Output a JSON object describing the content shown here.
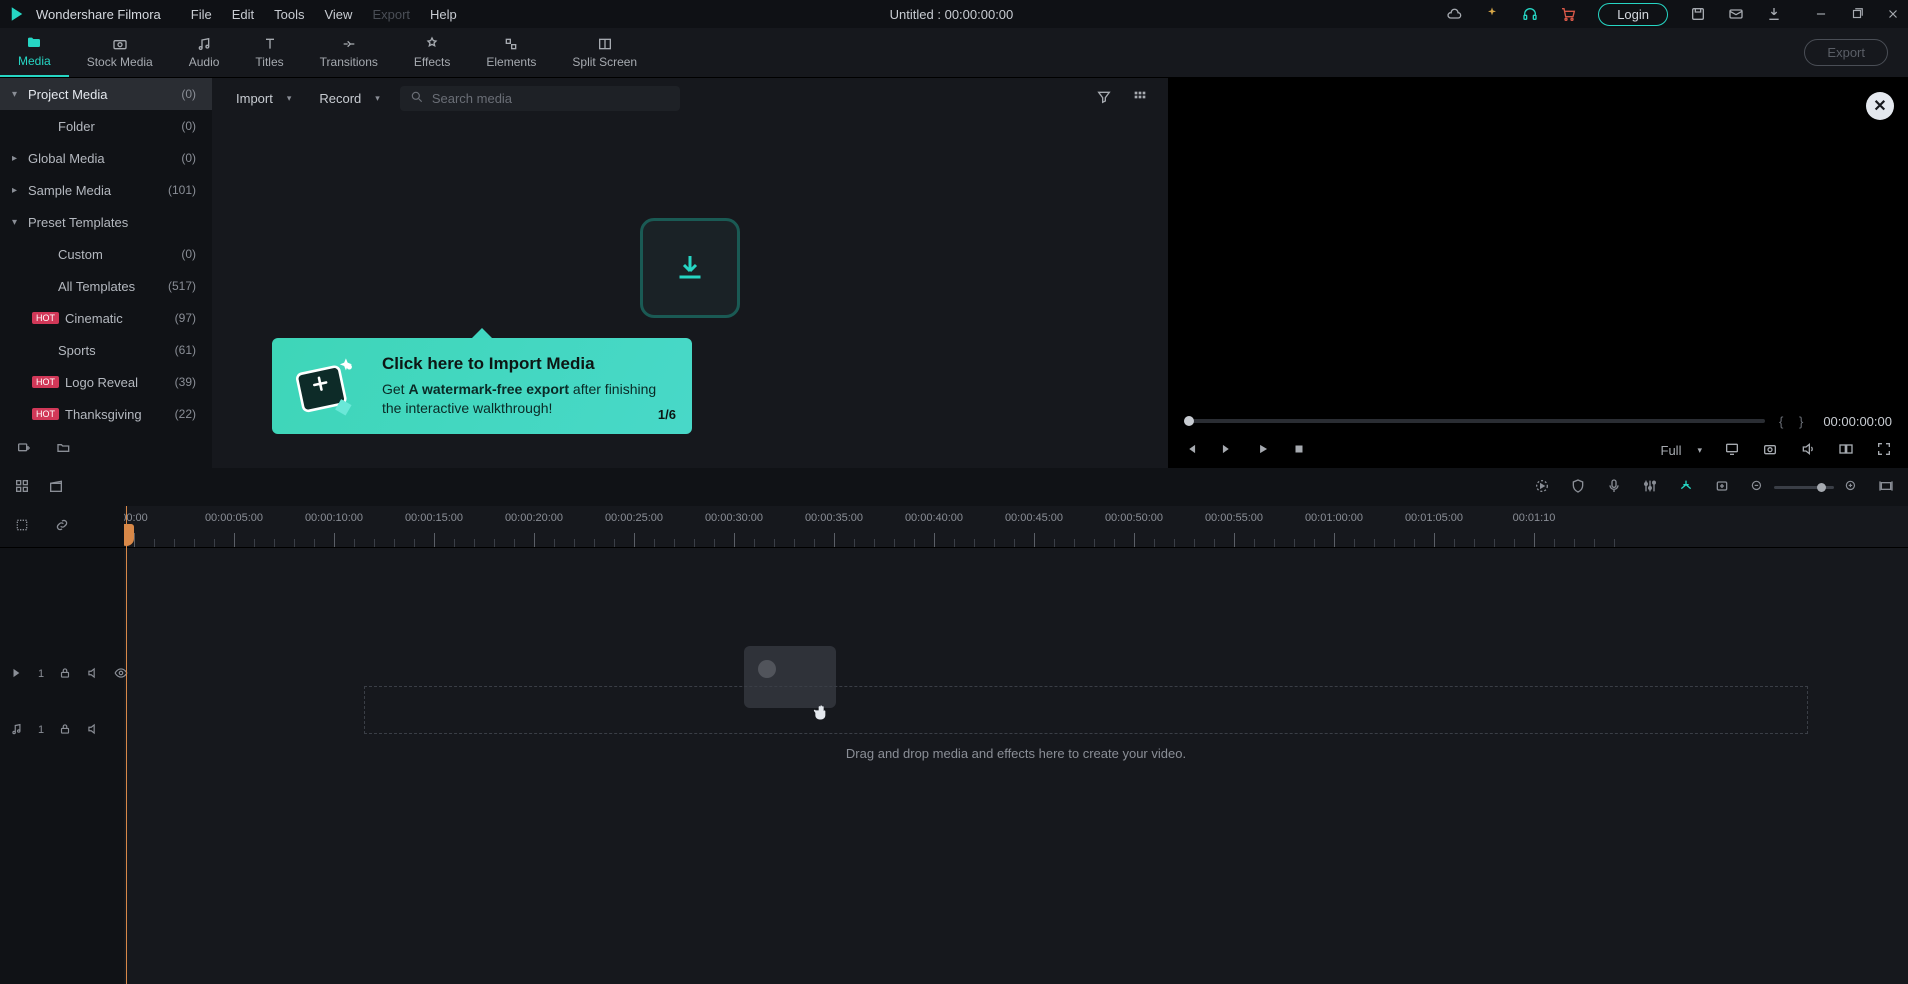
{
  "app": {
    "name": "Wondershare Filmora"
  },
  "menu": {
    "file": "File",
    "edit": "Edit",
    "tools": "Tools",
    "view": "View",
    "export": "Export",
    "help": "Help"
  },
  "title": {
    "text": "Untitled  :  00:00:00:00"
  },
  "titlebar": {
    "login": "Login"
  },
  "tabs": {
    "media": "Media",
    "stock_media": "Stock Media",
    "audio": "Audio",
    "titles": "Titles",
    "transitions": "Transitions",
    "effects": "Effects",
    "elements": "Elements",
    "split_screen": "Split Screen",
    "export_btn": "Export"
  },
  "sidebar": {
    "items": [
      {
        "label": "Project Media",
        "count": "(0)",
        "expand": "▾"
      },
      {
        "label": "Folder",
        "count": "(0)"
      },
      {
        "label": "Global Media",
        "count": "(0)",
        "expand": "▸"
      },
      {
        "label": "Sample Media",
        "count": "(101)",
        "expand": "▸"
      },
      {
        "label": "Preset Templates",
        "expand": "▾"
      },
      {
        "label": "Custom",
        "count": "(0)"
      },
      {
        "label": "All Templates",
        "count": "(517)"
      },
      {
        "label": "Cinematic",
        "count": "(97)",
        "hot": "HOT"
      },
      {
        "label": "Sports",
        "count": "(61)"
      },
      {
        "label": "Logo Reveal",
        "count": "(39)",
        "hot": "HOT"
      },
      {
        "label": "Thanksgiving",
        "count": "(22)",
        "hot": "HOT"
      }
    ]
  },
  "media_toolbar": {
    "import": "Import",
    "record": "Record",
    "search_placeholder": "Search media"
  },
  "tooltip": {
    "title": "Click here to Import Media",
    "body_pre": "Get ",
    "body_bold": "A watermark-free export",
    "body_post": " after finishing the interactive walkthrough!",
    "step": "1/6"
  },
  "preview": {
    "time": "00:00:00:00",
    "quality": "Full"
  },
  "ruler": {
    "ticks": [
      "00:00",
      "00:00:05:00",
      "00:00:10:00",
      "00:00:15:00",
      "00:00:20:00",
      "00:00:25:00",
      "00:00:30:00",
      "00:00:35:00",
      "00:00:40:00",
      "00:00:45:00",
      "00:00:50:00",
      "00:00:55:00",
      "00:01:00:00",
      "00:01:05:00",
      "00:01:10"
    ]
  },
  "tracks": {
    "video": {
      "idx": "1"
    },
    "audio": {
      "idx": "1"
    }
  },
  "timeline": {
    "drop_hint": "Drag and drop media and effects here to create your video."
  }
}
